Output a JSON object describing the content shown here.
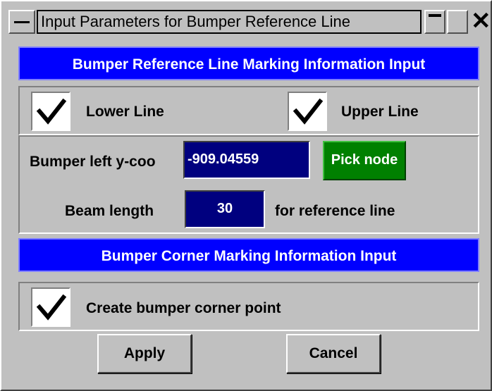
{
  "window": {
    "title": "Input Parameters for Bumper Reference Line"
  },
  "reference_section": {
    "header": "Bumper Reference Line Marking Information Input",
    "lower_line": {
      "label": "Lower Line",
      "checked": true
    },
    "upper_line": {
      "label": "Upper Line",
      "checked": true
    },
    "bumper_left_label": "Bumper left y-coo",
    "bumper_left_value": "-909.04559",
    "pick_node_label": "Pick node",
    "beam_length_label": "Beam length",
    "beam_length_value": "30",
    "beam_length_suffix": "for reference line"
  },
  "corner_section": {
    "header": "Bumper Corner Marking Information Input",
    "create_corner": {
      "label": "Create bumper corner point",
      "checked": true
    }
  },
  "actions": {
    "apply_label": "Apply",
    "cancel_label": "Cancel"
  },
  "colors": {
    "header_bg": "#0000ff",
    "field_bg": "#00007f",
    "pick_button_bg": "#008000",
    "window_bg": "#c0c0c0"
  }
}
